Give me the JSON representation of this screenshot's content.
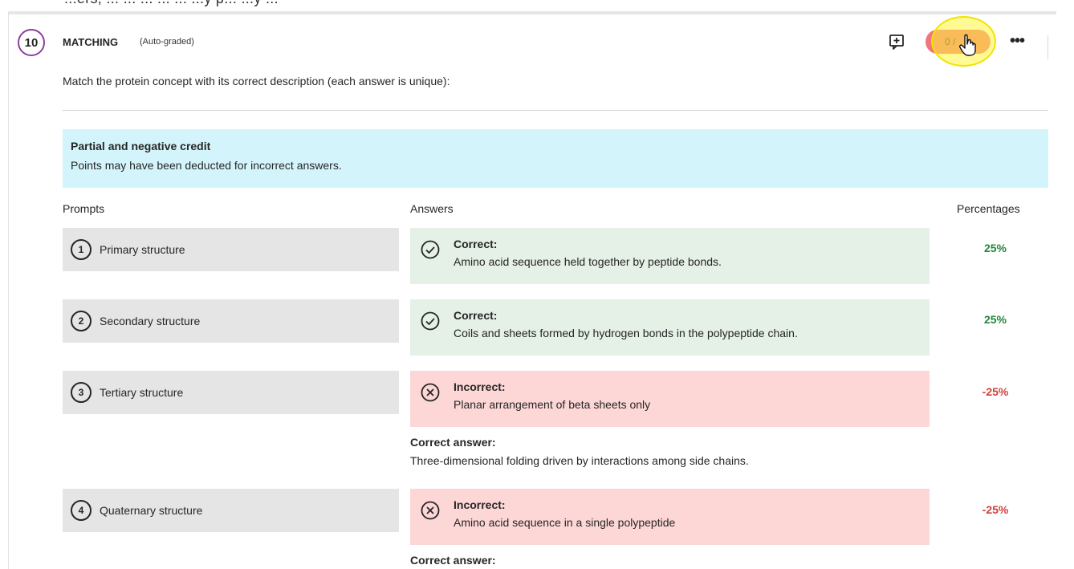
{
  "top_text": "...ers, ... ... ... ... ... ...y p... ...y ...",
  "question": {
    "number": "10",
    "type": "MATCHING",
    "grading": "(Auto-graded)",
    "score": "0 /",
    "instructions": "Match the protein concept with its correct description (each answer is unique):"
  },
  "icons": {
    "add_feedback": "add-comment-icon",
    "cursor": "hand-pointer-icon",
    "more": "more-options-icon",
    "correct": "check-circle-icon",
    "incorrect": "x-circle-icon"
  },
  "info": {
    "title": "Partial and negative credit",
    "text": "Points may have been deducted for incorrect answers."
  },
  "columns": {
    "prompts": "Prompts",
    "answers": "Answers",
    "percentages": "Percentages"
  },
  "rows": [
    {
      "number": "1",
      "prompt": "Primary structure",
      "status": "Correct:",
      "answer": "Amino acid sequence held together by peptide bonds.",
      "percent": "25%"
    },
    {
      "number": "2",
      "prompt": "Secondary structure",
      "status": "Correct:",
      "answer": "Coils and sheets formed by hydrogen bonds in the polypeptide chain.",
      "percent": "25%"
    },
    {
      "number": "3",
      "prompt": "Tertiary structure",
      "status": "Incorrect:",
      "answer": "Planar arrangement of beta sheets only",
      "percent": "-25%",
      "correct_answer_label": "Correct answer:",
      "correct_answer": "Three-dimensional folding driven by interactions among side chains."
    },
    {
      "number": "4",
      "prompt": "Quaternary structure",
      "status": "Incorrect:",
      "answer": "Amino acid sequence in a single polypeptide",
      "percent": "-25%",
      "correct_answer_label": "Correct answer:"
    }
  ],
  "colors": {
    "question_ring": "#8c3f9e",
    "info_bg": "#d4f4fb",
    "correct_bg": "#e5f0e6",
    "incorrect_bg": "#fdd6d6",
    "positive": "#23883a",
    "negative": "#d2403a",
    "score_pill": "#f1757c",
    "highlight": "#fff63c"
  }
}
